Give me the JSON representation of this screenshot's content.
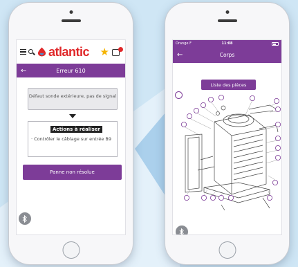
{
  "left_screen": {
    "brand": {
      "name": "atlantic"
    },
    "header": {
      "title": "Erreur 610"
    },
    "error_message": "Défaut sonde extérieure, pas de signal",
    "actions": {
      "title": "Actions à réaliser",
      "text": "· Contrôler le câblage sur entrée B9"
    },
    "button_label": "Panne non résolue"
  },
  "right_screen": {
    "status": {
      "carrier": "Orange F",
      "time": "11:08"
    },
    "header": {
      "title": "Corps"
    },
    "button_label": "Liste des pièces"
  },
  "colors": {
    "accent": "#7d3c98",
    "brand_red": "#e0282a",
    "star": "#f5b400",
    "background": "#cfe6f5"
  },
  "icons": [
    "hamburger-icon",
    "search-icon",
    "atlantic-logo-icon",
    "star-icon",
    "cart-icon",
    "back-arrow-icon",
    "bluetooth-icon"
  ]
}
